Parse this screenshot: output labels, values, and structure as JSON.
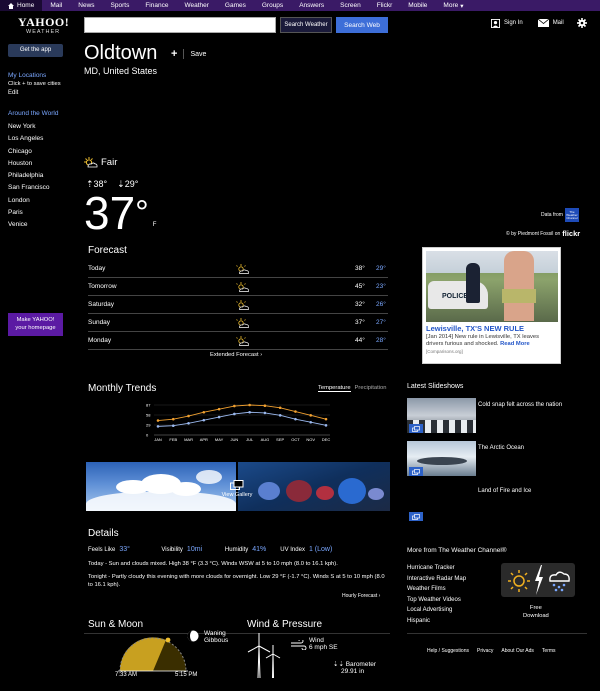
{
  "nav": {
    "items": [
      "Home",
      "Mail",
      "News",
      "Sports",
      "Finance",
      "Weather",
      "Games",
      "Groups",
      "Answers",
      "Screen",
      "Flickr",
      "Mobile",
      "More"
    ],
    "more_arrow": "▾"
  },
  "logo": {
    "brand": "YAHOO!",
    "sub": "WEATHER"
  },
  "search": {
    "placeholder": "",
    "weather_btn": "Search Weather",
    "web_btn": "Search Web"
  },
  "user": {
    "signin": "Sign In",
    "mail": "Mail"
  },
  "sidebar": {
    "get_app": "Get the app",
    "my_locations": "My Locations",
    "click_save": "Click + to save cities",
    "edit": "Edit",
    "around": "Around the World",
    "cities": [
      "New York",
      "Los Angeles",
      "Chicago",
      "Houston",
      "Philadelphia",
      "San Francisco",
      "London",
      "Paris",
      "Venice"
    ],
    "make1": "Make YAHOO!",
    "make2": "your homepage"
  },
  "location": {
    "city": "Oldtown",
    "save": "Save",
    "region": "MD, United States"
  },
  "current": {
    "condition": "Fair",
    "high": "38°",
    "low": "29°",
    "temp": "37",
    "deg": "°",
    "unit": "F"
  },
  "credits": {
    "data_from": "Data from",
    "twc_logo": "The Weather Channel",
    "by": "© by Piedmont Fossil on",
    "flickr": "flickr"
  },
  "forecast": {
    "title": "Forecast",
    "rows": [
      {
        "day": "Today",
        "hi": "38°",
        "lo": "29°"
      },
      {
        "day": "Tomorrow",
        "hi": "45°",
        "lo": "23°"
      },
      {
        "day": "Saturday",
        "hi": "32°",
        "lo": "26°"
      },
      {
        "day": "Sunday",
        "hi": "37°",
        "lo": "27°"
      },
      {
        "day": "Monday",
        "hi": "44°",
        "lo": "28°"
      }
    ],
    "extended": "Extended Forecast ›"
  },
  "ad": {
    "car_text": "POLICE",
    "headline": "Lewisville, TX'S NEW RULE",
    "body": "[Jan 2014] New rule in Lewisville, TX leaves drivers furious and shocked.",
    "read_more": "Read More",
    "source": "[Comparisons.org]"
  },
  "trends": {
    "title": "Monthly Trends",
    "tab_on": "Temperature",
    "tab_off": "Precipitation"
  },
  "chart_data": {
    "type": "line",
    "categories": [
      "JAN",
      "FEB",
      "MAR",
      "APR",
      "MAY",
      "JUN",
      "JUL",
      "AUG",
      "SEP",
      "OCT",
      "NOV",
      "DEC"
    ],
    "series": [
      {
        "values": [
          42,
          46,
          55,
          66,
          75,
          84,
          87,
          85,
          79,
          68,
          57,
          46
        ],
        "color": "#f0a030"
      },
      {
        "values": [
          25,
          27,
          34,
          43,
          52,
          61,
          66,
          64,
          57,
          46,
          37,
          28
        ],
        "color": "#9ab8ee"
      }
    ],
    "yticks": [
      0,
      29,
      58,
      87
    ],
    "ylim": [
      0,
      87
    ]
  },
  "gallery": {
    "label": "View Gallery"
  },
  "details": {
    "title": "Details",
    "feels_k": "Feels Like",
    "feels_v": "33°",
    "vis_k": "Visibility",
    "vis_v": "10mi",
    "hum_k": "Humidity",
    "hum_v": "41%",
    "uv_k": "UV Index",
    "uv_v": "1 (Low)",
    "today": "Today - Sun and clouds mixed. High 38 °F (3.3 °C). Winds WSW at 5 to 10 mph (8.0 to 16.1 kph).",
    "tonight": "Tonight - Partly cloudy this evening with more clouds for overnight. Low 29 °F (-1.7 °C). Winds S at 5 to 10 mph (8.0 to 16.1 kph).",
    "hourly": "Hourly Forecast ›"
  },
  "slideshows": {
    "title": "Latest Slideshows",
    "items": [
      "Cold snap felt across the nation",
      "The Arctic Ocean",
      "Land of Fire and Ice"
    ]
  },
  "more": {
    "title": "More from The Weather Channel®",
    "links": [
      "Hurricane Tracker",
      "Interactive Radar Map",
      "Weather Films",
      "Top Weather Videos",
      "Local Advertising",
      "Hispanic"
    ],
    "free": "Free",
    "download": "Download"
  },
  "sunmoon": {
    "title": "Sun & Moon",
    "rise": "7:33 AM",
    "set": "5:15 PM",
    "moon1": "Waning",
    "moon2": "Gibbous"
  },
  "wind": {
    "title": "Wind & Pressure",
    "w1": "Wind",
    "w2": "6 mph SE",
    "b1": "Barometer",
    "b2": "29.91 in"
  },
  "footer": {
    "links": [
      "Help / Suggestions",
      "Privacy",
      "About Our Ads",
      "Terms"
    ]
  }
}
